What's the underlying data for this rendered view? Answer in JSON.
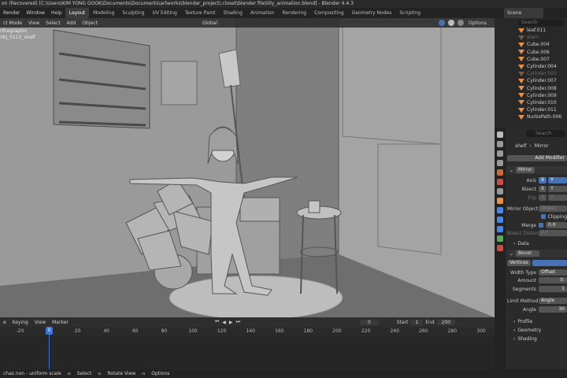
{
  "titlebar": {
    "text": "on (Recovered) [C:\\Users\\KIM YONG GOOK\\Documents\\Documents\\artworks\\blender_project\\.closet\\blender file\\lilly_animation.blend] - Blender 4.4.3"
  },
  "menu": {
    "items": [
      "Render",
      "Window",
      "Help"
    ]
  },
  "workspaces": [
    "Layout",
    "Modeling",
    "Sculpting",
    "UV Editing",
    "Texture Paint",
    "Shading",
    "Animation",
    "Rendering",
    "Compositing",
    "Geometry Nodes",
    "Scripting"
  ],
  "scene": {
    "label": "Scene"
  },
  "viewport_header": {
    "mode": "ct Mode",
    "items": [
      "View",
      "Select",
      "Add",
      "Object"
    ],
    "transform": "Global",
    "options": "Options"
  },
  "viewport_overlay": {
    "line1": "rthographic",
    "line2": "obj_0112_shelf"
  },
  "outliner": {
    "search_placeholder": "Search",
    "items": [
      {
        "name": "leaf.011",
        "dim": false
      },
      {
        "name": "stem",
        "dim": true
      },
      {
        "name": "Cube.004",
        "dim": false
      },
      {
        "name": "Cube.006",
        "dim": false
      },
      {
        "name": "Cube.007",
        "dim": false
      },
      {
        "name": "Cylinder.004",
        "dim": false
      },
      {
        "name": "Cylinder.005",
        "dim": true
      },
      {
        "name": "Cylinder.007",
        "dim": false
      },
      {
        "name": "Cylinder.008",
        "dim": false
      },
      {
        "name": "Cylinder.009",
        "dim": false
      },
      {
        "name": "Cylinder.010",
        "dim": false
      },
      {
        "name": "Cylinder.011",
        "dim": false
      },
      {
        "name": "NurbsPath.006",
        "dim": false
      }
    ]
  },
  "properties": {
    "search_placeholder": "Search",
    "breadcrumb_object": "shelf",
    "breadcrumb_modifier": "Mirror",
    "add_modifier": "Add Modifier",
    "mirror": {
      "name": "Mirror",
      "axis_label": "Axis",
      "bisect_label": "Bisect",
      "flip_label": "Flip",
      "x": "X",
      "y": "Y",
      "mirror_object_label": "Mirror Object",
      "mirror_object_placeholder": "Object",
      "clipping": "Clipping",
      "merge_label": "Merge",
      "merge_value": "0.0",
      "bisect_distance_label": "Bisect Distan...",
      "bisect_distance_value": "0.0",
      "data": "Data"
    },
    "bevel": {
      "name": "Bevel",
      "vertices": "Vertices",
      "width_type_label": "Width Type",
      "width_type_value": "Offset",
      "amount_label": "Amount",
      "amount_value": "0.",
      "segments_label": "Segments",
      "segments_value": "1",
      "limit_method_label": "Limit Method",
      "limit_method_value": "Angle",
      "angle_label": "Angle",
      "angle_value": "30",
      "profile": "Profile",
      "geometry": "Geometry",
      "shading": "Shading"
    }
  },
  "timeline": {
    "playback": "e",
    "keying": "Keying",
    "view": "View",
    "marker": "Marker",
    "current_frame": "0",
    "start_label": "Start",
    "start_value": "1",
    "end_label": "End",
    "end_value": "200",
    "ticks": [
      "-20",
      "0",
      "20",
      "40",
      "60",
      "80",
      "100",
      "120",
      "140",
      "160",
      "180",
      "200",
      "220",
      "240",
      "260",
      "280",
      "300"
    ],
    "playhead": "0"
  },
  "status": {
    "items": [
      "chas non - uniform scale",
      "Select",
      "Rotate View",
      "Options"
    ]
  }
}
